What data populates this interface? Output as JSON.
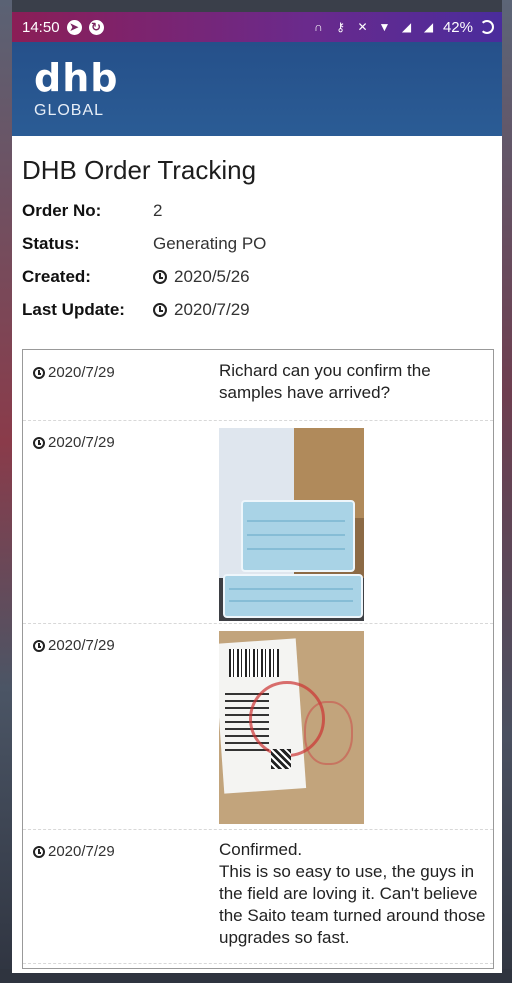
{
  "status_bar": {
    "time": "14:50",
    "battery": "42%",
    "icons": [
      "telegram-icon",
      "sync-icon",
      "headset-icon",
      "key-icon",
      "mute-icon",
      "wifi-icon",
      "signal-icon",
      "signal-icon",
      "battery-icon"
    ]
  },
  "header": {
    "logo_main": "dhb",
    "logo_sub": "GLOBAL",
    "background": "#2b5c95"
  },
  "page": {
    "title": "DHB Order Tracking"
  },
  "order": {
    "number_label": "Order No:",
    "number": "2",
    "status_label": "Status:",
    "status": "Generating PO",
    "created_label": "Created:",
    "created": "2020/5/26",
    "updated_label": "Last Update:",
    "updated": "2020/7/29"
  },
  "feed": [
    {
      "date": "2020/7/29",
      "type": "text",
      "text": "Richard can you confirm the samples have arrived?"
    },
    {
      "date": "2020/7/29",
      "type": "photo",
      "subject": "face masks in box"
    },
    {
      "date": "2020/7/29",
      "type": "photo",
      "subject": "shipping label with stamp"
    },
    {
      "date": "2020/7/29",
      "type": "text",
      "text_line1": "Confirmed.",
      "text_line2": "This is so easy to use, the guys in the field are loving it. Can't believe the Saito team turned around those upgrades so fast."
    }
  ]
}
